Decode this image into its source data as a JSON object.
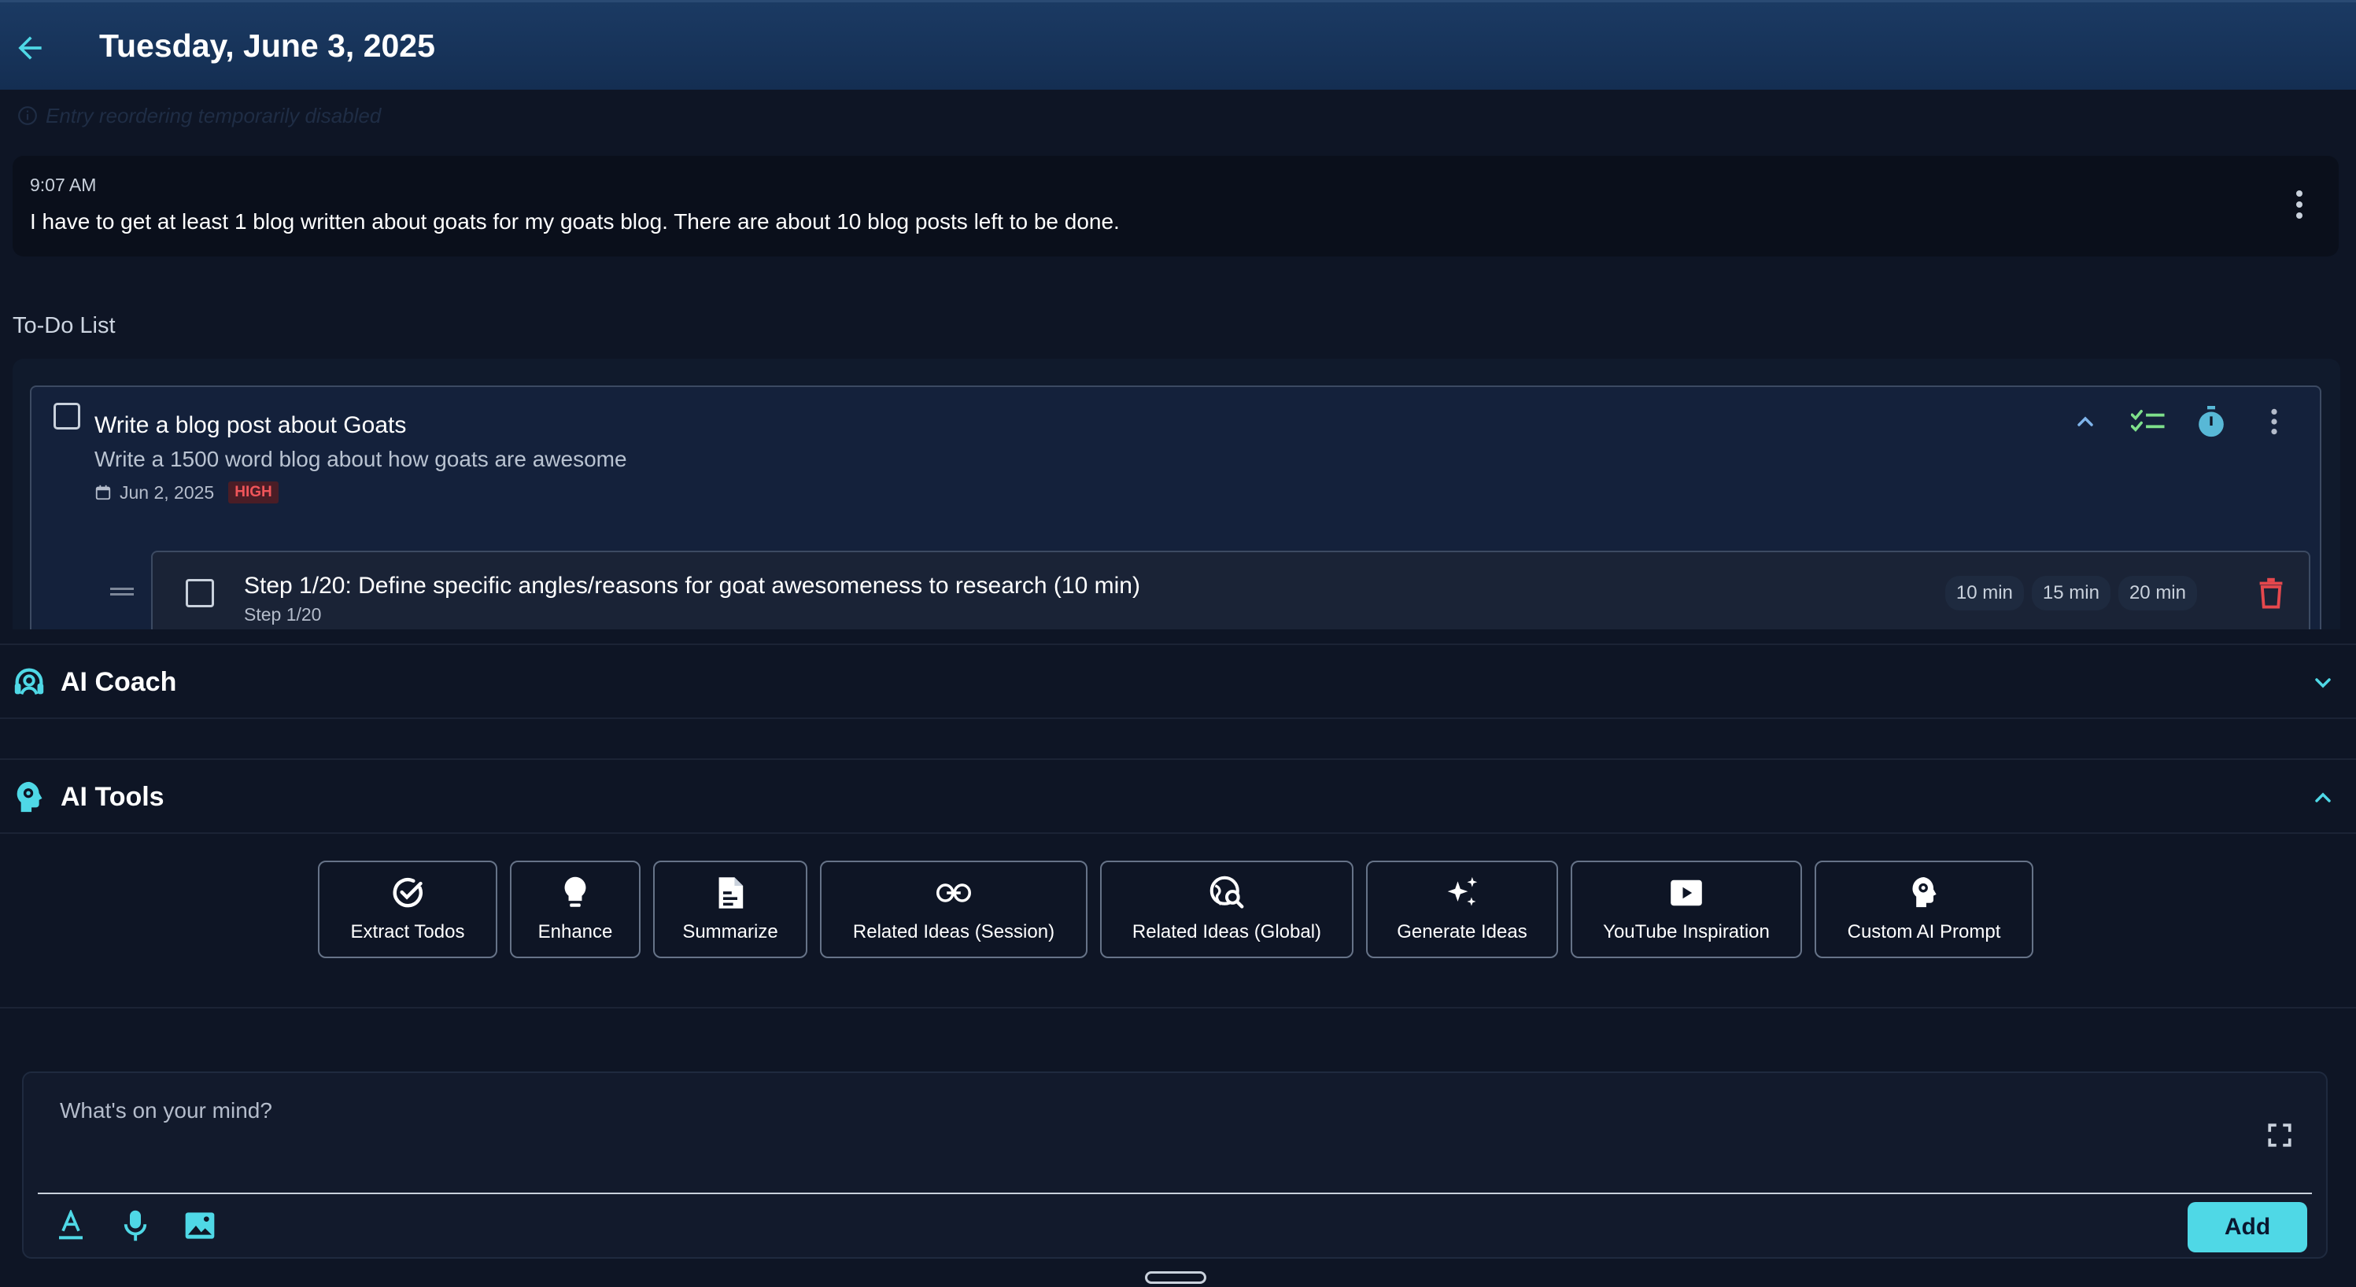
{
  "header": {
    "title": "Tuesday, June 3, 2025",
    "back_icon": "arrow-left-icon"
  },
  "notice": {
    "text": "Entry reordering temporarily disabled",
    "icon": "info-icon"
  },
  "entry": {
    "time": "9:07 AM",
    "text": "I have to get at least 1 blog written about goats for my goats blog. There are about 10 blog posts left to be done."
  },
  "todo_section": {
    "label": "To-Do List",
    "items": [
      {
        "title": "Write a blog post about Goats",
        "description": "Write a 1500 word blog about how goats are awesome",
        "date": "Jun 2, 2025",
        "priority": "HIGH",
        "steps": [
          {
            "title": "Step 1/20: Define specific angles/reasons for goat awesomeness to research (10 min)",
            "subtitle": "Step 1/20",
            "durations": [
              "10 min",
              "15 min",
              "20 min"
            ]
          }
        ]
      }
    ]
  },
  "ai_coach": {
    "title": "AI Coach",
    "expanded": false
  },
  "ai_tools": {
    "title": "AI Tools",
    "expanded": true,
    "tools": [
      {
        "label": "Extract Todos",
        "icon": "check-circle-icon"
      },
      {
        "label": "Enhance",
        "icon": "lightbulb-icon"
      },
      {
        "label": "Summarize",
        "icon": "document-icon"
      },
      {
        "label": "Related Ideas (Session)",
        "icon": "link-icon"
      },
      {
        "label": "Related Ideas (Global)",
        "icon": "globe-search-icon"
      },
      {
        "label": "Generate Ideas",
        "icon": "sparkles-icon"
      },
      {
        "label": "YouTube Inspiration",
        "icon": "youtube-icon"
      },
      {
        "label": "Custom AI Prompt",
        "icon": "brain-icon"
      }
    ]
  },
  "composer": {
    "placeholder": "What's on your mind?",
    "value": "",
    "add_label": "Add"
  },
  "colors": {
    "accent": "#4fd8e6",
    "header_bg": "#1b3a63",
    "page_bg": "#0e1525",
    "priority_high": "#f0555a",
    "checklist_green": "#7ee08b",
    "delete_red": "#e5484d"
  }
}
